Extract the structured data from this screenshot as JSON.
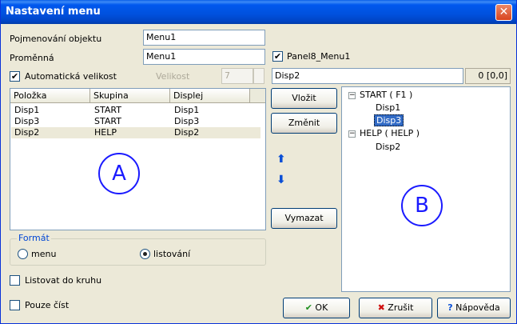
{
  "window": {
    "title": "Nastavení menu",
    "close_label": "✕"
  },
  "form": {
    "name_label": "Pojmenování objektu",
    "name_value": "Menu1",
    "variable_label": "Proměnná",
    "variable_value": "Menu1",
    "panel_check_label": "Panel8_Menu1",
    "panel_checked": true,
    "auto_size_label": "Automatická velikost",
    "auto_size_checked": true,
    "size_label": "Velikost",
    "size_value": "7",
    "disp_value": "Disp2",
    "disp_info": "0  [0,0]"
  },
  "table": {
    "columns": [
      "Položka",
      "Skupina",
      "Displej"
    ],
    "rows": [
      [
        "Disp1",
        "START",
        "Disp1"
      ],
      [
        "Disp3",
        "START",
        "Disp3"
      ],
      [
        "Disp2",
        "HELP",
        "Disp2"
      ]
    ],
    "annotation": "A"
  },
  "buttons": {
    "insert": "Vložit",
    "change": "Změnit",
    "delete": "Vymazat",
    "ok": "OK",
    "cancel": "Zrušit",
    "help": "Nápověda"
  },
  "format": {
    "title": "Formát",
    "option_menu": "menu",
    "option_browse": "listování",
    "selected": "listování"
  },
  "options": {
    "loop_label": "Listovat do kruhu",
    "readonly_label": "Pouze číst"
  },
  "tree": {
    "nodes": [
      {
        "label": "START ( F1 )",
        "children": [
          "Disp1",
          "Disp3"
        ]
      },
      {
        "label": "HELP ( HELP )",
        "children": [
          "Disp2"
        ]
      }
    ],
    "selected": "Disp3",
    "annotation": "B",
    "expander": "−"
  },
  "colors": {
    "title_bar": "#0058ee",
    "selection": "#316ac5",
    "annotation": "#1a1aff"
  }
}
